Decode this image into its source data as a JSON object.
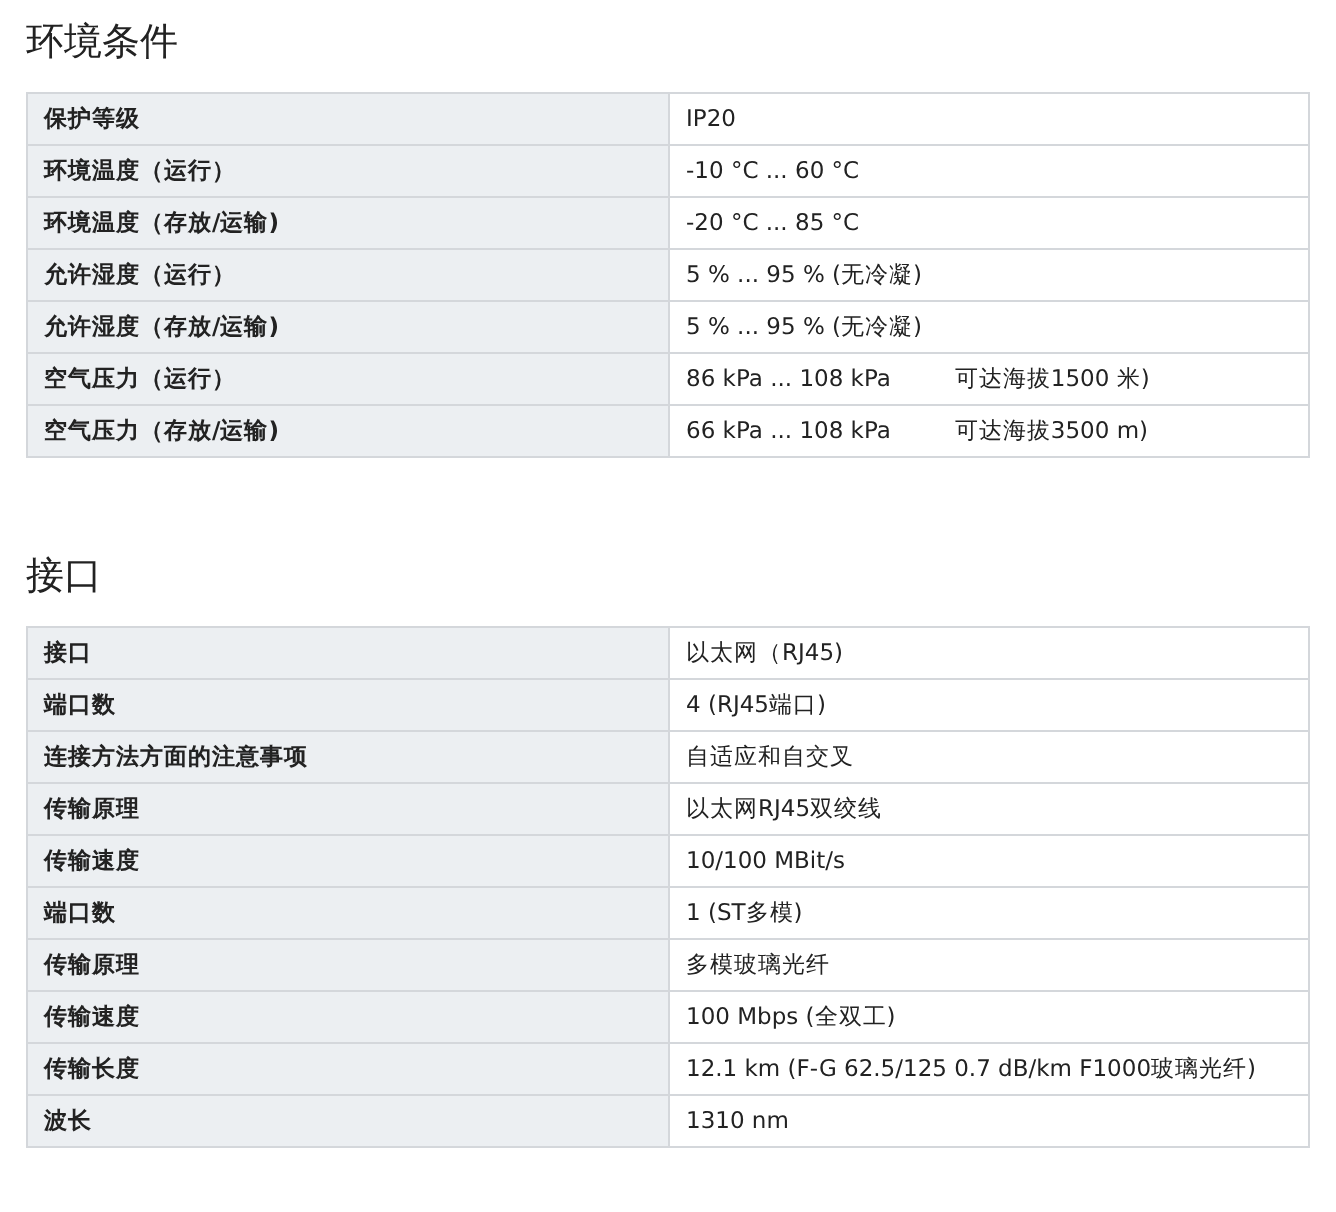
{
  "sections": [
    {
      "title": "环境条件",
      "rows": [
        {
          "label": "保护等级",
          "value": "IP20"
        },
        {
          "label": "环境温度（运行）",
          "value": "-10 °C ... 60 °C"
        },
        {
          "label": "环境温度（存放/运输)",
          "value": "-20 °C ... 85 °C"
        },
        {
          "label": "允许湿度（运行）",
          "value": "5 % ... 95 % (无冷凝)"
        },
        {
          "label": "允许湿度（存放/运输)",
          "value": "5 % ... 95 % (无冷凝)"
        },
        {
          "label": "空气压力（运行）",
          "value": "86 kPa ... 108 kPa",
          "note": "可达海拔1500 米)"
        },
        {
          "label": "空气压力（存放/运输)",
          "value": "66 kPa ... 108 kPa",
          "note": "可达海拔3500 m)"
        }
      ]
    },
    {
      "title": "接口",
      "rows": [
        {
          "label": "接口",
          "value": "以太网（RJ45)"
        },
        {
          "label": "端口数",
          "value": "4 (RJ45端口)"
        },
        {
          "label": "连接方法方面的注意事项",
          "value": "自适应和自交叉"
        },
        {
          "label": "传输原理",
          "value": "以太网RJ45双绞线"
        },
        {
          "label": "传输速度",
          "value": "10/100 MBit/s"
        },
        {
          "label": "端口数",
          "value": "1 (ST多模)"
        },
        {
          "label": "传输原理",
          "value": "多模玻璃光纤"
        },
        {
          "label": "传输速度",
          "value": "100 Mbps (全双工)"
        },
        {
          "label": "传输长度",
          "value": "12.1 km (F-G 62.5/125 0.7 dB/km F1000玻璃光纤)"
        },
        {
          "label": "波长",
          "value": "1310 nm"
        }
      ]
    }
  ]
}
